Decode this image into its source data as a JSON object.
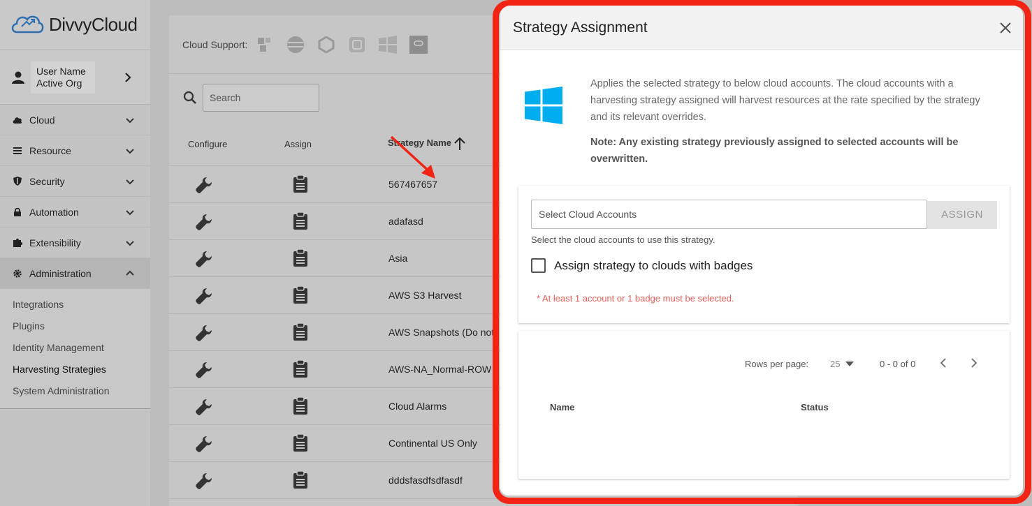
{
  "app": {
    "brand": "DivvyCloud"
  },
  "user": {
    "name": "User Name",
    "org": "Active Org"
  },
  "sidebar": {
    "items": [
      {
        "label": "Cloud",
        "icon": "cloud-icon"
      },
      {
        "label": "Resource",
        "icon": "list-icon"
      },
      {
        "label": "Security",
        "icon": "shield-icon"
      },
      {
        "label": "Automation",
        "icon": "lock-icon"
      },
      {
        "label": "Extensibility",
        "icon": "puzzle-icon"
      },
      {
        "label": "Administration",
        "icon": "gear-icon"
      }
    ],
    "subitems": [
      "Integrations",
      "Plugins",
      "Identity Management",
      "Harvesting Strategies",
      "System Administration"
    ],
    "current": "Harvesting Strategies"
  },
  "main": {
    "cloud_support_label": "Cloud Support:",
    "search_placeholder": "Search",
    "columns": {
      "configure": "Configure",
      "assign": "Assign",
      "strategy_name": "Strategy Name"
    },
    "rows": [
      "567467657",
      "adafasd",
      "Asia",
      "AWS S3 Harvest",
      "AWS Snapshots (Do not",
      "AWS-NA_Normal-ROW",
      "Cloud Alarms",
      "Continental US Only",
      "dddsfasdfsdfasdf"
    ]
  },
  "modal": {
    "title": "Strategy Assignment",
    "description": "Applies the selected strategy to below cloud accounts. The cloud accounts with a harvesting strategy assigned will harvest resources at the rate specified by the strategy and its relevant overrides.",
    "note": "Note: Any existing strategy previously assigned to selected accounts will be overwritten.",
    "select_placeholder": "Select Cloud Accounts",
    "assign_label": "ASSIGN",
    "helper": "Select the cloud accounts to use this strategy.",
    "badge_checkbox_label": "Assign strategy to clouds with badges",
    "error": "* At least 1 account or 1 badge must be selected.",
    "rows_per_page_label": "Rows per page:",
    "rows_per_page": "25",
    "page_range": "0 - 0 of 0",
    "col_name": "Name",
    "col_status": "Status"
  },
  "colors": {
    "annotation": "#f42414",
    "windows_blue": "#00adef",
    "error": "#e4605a"
  }
}
